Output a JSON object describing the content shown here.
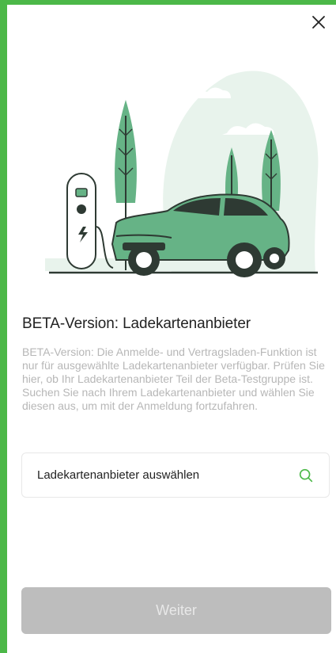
{
  "close": {
    "icon": "close-icon"
  },
  "illustration": {
    "icon": "ev-charging-illustration"
  },
  "title": "BETA-Version: Ladekartenanbieter",
  "description": {
    "paragraph1": "BETA-Version: Die Anmelde- und Vertragsladen-Funktion ist nur für ausgewählte Ladekartenanbieter verfügbar. Prüfen Sie hier, ob Ihr Ladekartenanbieter Teil der Beta-Testgruppe ist.",
    "paragraph2": "Suchen Sie nach Ihrem Ladekartenanbieter und wählen Sie diesen aus, um mit der Anmeldung fortzufahren."
  },
  "search": {
    "label": "Ladekartenanbieter auswählen",
    "icon": "search-icon"
  },
  "button": {
    "label": "Weiter"
  },
  "colors": {
    "accent": "#4cb848",
    "illustration_green": "#66b386",
    "button_disabled": "#bdbdbd"
  }
}
